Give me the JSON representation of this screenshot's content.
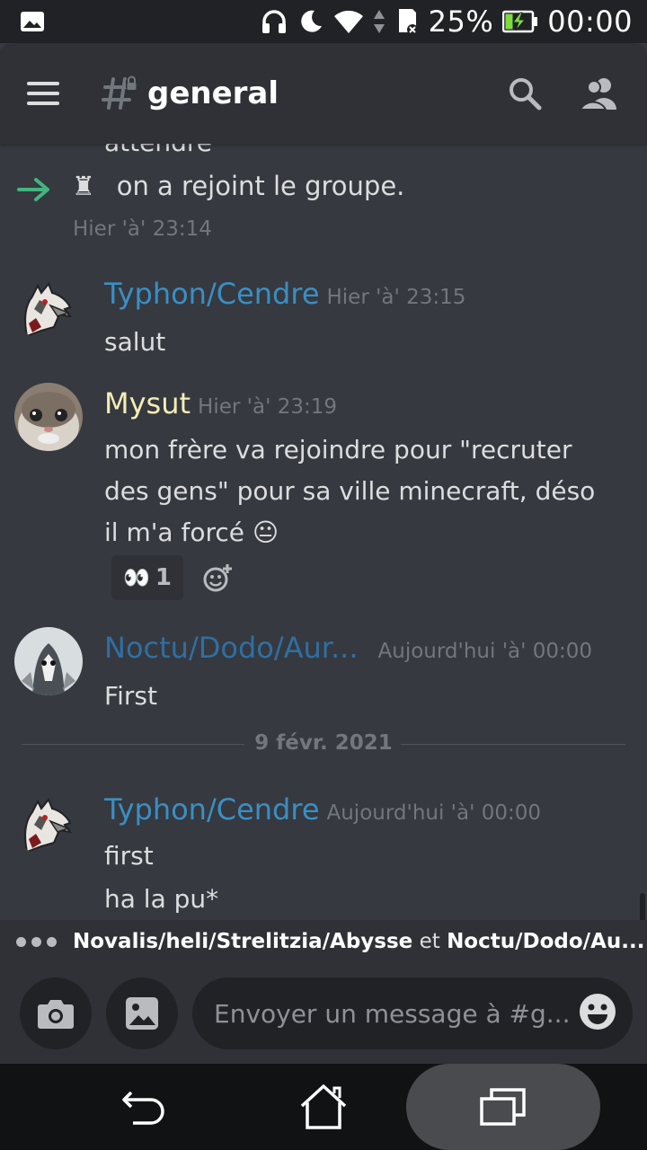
{
  "status_bar": {
    "battery": "25%",
    "time": "00:00",
    "icons": [
      "image-icon",
      "headphones-icon",
      "moon-icon",
      "wifi-icon",
      "data-arrows-icon",
      "sd-card-icon",
      "battery-charging-icon"
    ]
  },
  "header": {
    "channel_name": "general",
    "menu_icon": "hamburger-icon",
    "channel_icon": "locked-hash-icon",
    "search_icon": "search-icon",
    "members_icon": "members-icon"
  },
  "messages": {
    "clipped_text": "attendre",
    "join_event": {
      "text": "♜  on a rejoint le groupe.",
      "time": "Hier 'à' 23:14"
    },
    "items": [
      {
        "author": "Typhon/Cendre",
        "author_color": "#3a8fc4",
        "time": "Hier 'à' 23:15",
        "lines": [
          "salut"
        ]
      },
      {
        "author": "Mysut",
        "author_color": "#f4edb5",
        "time": "Hier 'à' 23:19",
        "text": "mon frère va rejoindre pour \"recruter des gens\" pour sa ville minecraft, déso il m'a forcé",
        "inline_emoji": "😐",
        "reaction": {
          "emoji": "👀",
          "count": "1"
        }
      },
      {
        "author": "Noctu/Dodo/Aur...",
        "author_color": "#2f6fa3",
        "time": "Aujourd'hui 'à' 00:00",
        "lines": [
          "First"
        ]
      },
      {
        "author": "Typhon/Cendre",
        "author_color": "#3a8fc4",
        "time": "Aujourd'hui 'à' 00:00",
        "lines": [
          "first",
          "ha la pu*"
        ]
      }
    ],
    "date_divider": "9 févr. 2021"
  },
  "typing": {
    "user1": "Novalis/heli/Strelitzia/Abysse",
    "conj": " et ",
    "user2": "Noctu/Dodo/Au..."
  },
  "composer": {
    "placeholder": "Envoyer un message à #g...",
    "camera_icon": "camera-icon",
    "gallery_icon": "image-icon",
    "emoji_icon": "smiley-icon"
  },
  "navbar": {
    "back_icon": "back-icon",
    "home_icon": "home-icon",
    "recents_icon": "recents-icon"
  },
  "colors": {
    "background": "#36393f",
    "header": "#2f3136",
    "join_arrow": "#43b581",
    "timestamp": "#72767d"
  }
}
